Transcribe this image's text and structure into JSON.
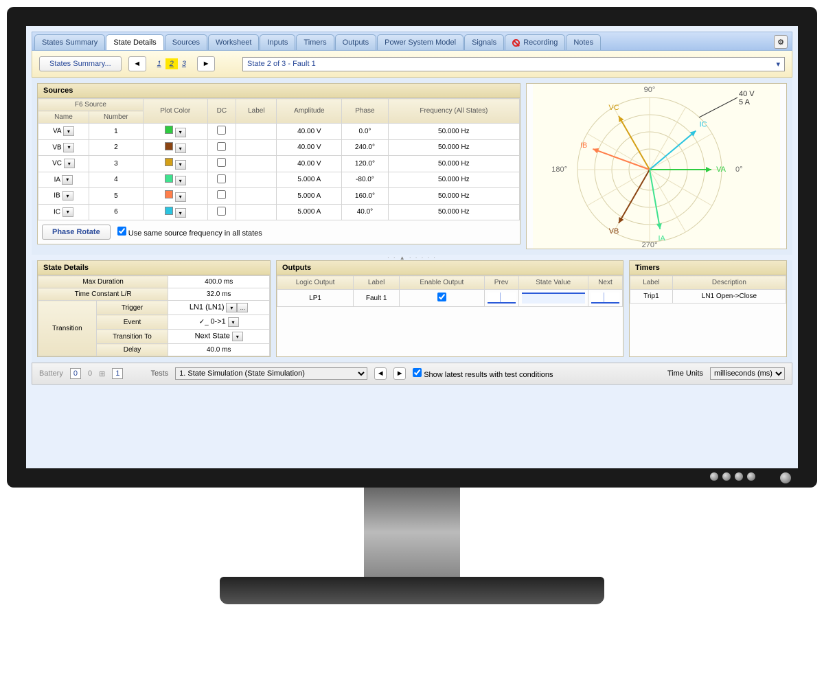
{
  "tabs": [
    "States Summary",
    "State Details",
    "Sources",
    "Worksheet",
    "Inputs",
    "Timers",
    "Outputs",
    "Power System Model",
    "Signals",
    "Recording",
    "Notes"
  ],
  "active_tab": 1,
  "toolbar": {
    "breadcrumb": "States Summary...",
    "pages": [
      "1",
      "2",
      "3"
    ],
    "active_page": 1,
    "state_selector": "State 2 of 3 - Fault 1"
  },
  "sources": {
    "title": "Sources",
    "group_header": "F6 Source",
    "columns": [
      "Name",
      "Number",
      "Plot Color",
      "DC",
      "Label",
      "Amplitude",
      "Phase",
      "Frequency (All States)"
    ],
    "rows": [
      {
        "name": "VA",
        "number": "1",
        "color": "#2ecc40",
        "amplitude": "40.00 V",
        "phase": "0.0°",
        "freq": "50.000 Hz"
      },
      {
        "name": "VB",
        "number": "2",
        "color": "#8b4513",
        "amplitude": "40.00 V",
        "phase": "240.0°",
        "freq": "50.000 Hz"
      },
      {
        "name": "VC",
        "number": "3",
        "color": "#d4a017",
        "amplitude": "40.00 V",
        "phase": "120.0°",
        "freq": "50.000 Hz"
      },
      {
        "name": "IA",
        "number": "4",
        "color": "#3fe28f",
        "amplitude": "5.000 A",
        "phase": "-80.0°",
        "freq": "50.000 Hz"
      },
      {
        "name": "IB",
        "number": "5",
        "color": "#ff7e4a",
        "amplitude": "5.000 A",
        "phase": "160.0°",
        "freq": "50.000 Hz"
      },
      {
        "name": "IC",
        "number": "6",
        "color": "#2bc4e0",
        "amplitude": "5.000 A",
        "phase": "40.0°",
        "freq": "50.000 Hz"
      }
    ],
    "phase_rotate": "Phase Rotate",
    "same_freq_label": "Use same source frequency in all states",
    "same_freq_checked": true
  },
  "phasor": {
    "angles": [
      "90°",
      "180°",
      "270°",
      "0°"
    ],
    "scale": "40 V\n5 A",
    "vectors": [
      {
        "label": "VA",
        "angle": 0,
        "color": "#2ecc40",
        "len": 90
      },
      {
        "label": "VB",
        "angle": 240,
        "color": "#8b4513",
        "len": 90
      },
      {
        "label": "VC",
        "angle": 120,
        "color": "#d4a017",
        "len": 90
      },
      {
        "label": "IA",
        "angle": -80,
        "color": "#3fe28f",
        "len": 88
      },
      {
        "label": "IB",
        "angle": 160,
        "color": "#ff7e4a",
        "len": 88
      },
      {
        "label": "IC",
        "angle": 40,
        "color": "#2bc4e0",
        "len": 88
      }
    ]
  },
  "state_details": {
    "title": "State Details",
    "max_duration_label": "Max Duration",
    "max_duration": "400.0 ms",
    "time_constant_label": "Time Constant L/R",
    "time_constant": "32.0 ms",
    "transition_label": "Transition",
    "trigger_label": "Trigger",
    "trigger": "LN1 (LN1)",
    "event_label": "Event",
    "event": "0->1",
    "transition_to_label": "Transition To",
    "transition_to": "Next State",
    "delay_label": "Delay",
    "delay": "40.0 ms"
  },
  "outputs": {
    "title": "Outputs",
    "columns": [
      "Logic Output",
      "Label",
      "Enable Output",
      "Prev",
      "State Value",
      "Next"
    ],
    "row": {
      "logic": "LP1",
      "label": "Fault 1",
      "enabled": true
    }
  },
  "timers": {
    "title": "Timers",
    "columns": [
      "Label",
      "Description"
    ],
    "row": {
      "label": "Trip1",
      "desc": "LN1 Open->Close"
    }
  },
  "status": {
    "battery_label": "Battery",
    "battery_val": "0",
    "batt_mid": "0",
    "batt_right": "1",
    "tests_label": "Tests",
    "tests_val": "1. State Simulation  (State Simulation)",
    "show_label": "Show latest results with test conditions",
    "show_checked": true,
    "units_label": "Time Units",
    "units_val": "milliseconds (ms)"
  }
}
